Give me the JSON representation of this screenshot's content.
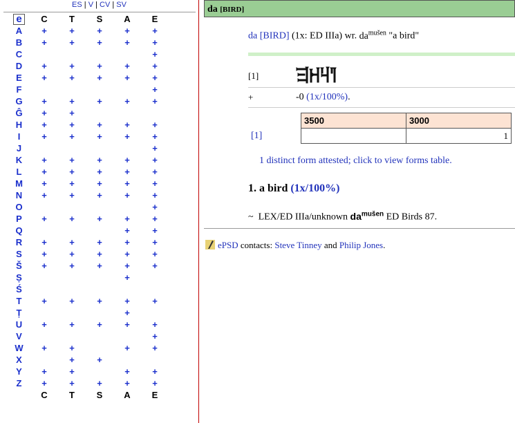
{
  "nav": {
    "links": [
      "ES",
      "V",
      "CV",
      "SV"
    ],
    "sep": "|"
  },
  "letter_grid": {
    "columns": [
      "C",
      "T",
      "S",
      "A",
      "E"
    ],
    "selected": "e",
    "rows": [
      {
        "letter": "A",
        "marks": [
          "+",
          "+",
          "+",
          "+",
          "+"
        ]
      },
      {
        "letter": "B",
        "marks": [
          "+",
          "+",
          "+",
          "+",
          "+"
        ]
      },
      {
        "letter": "C",
        "marks": [
          "",
          "",
          "",
          "",
          "+"
        ]
      },
      {
        "letter": "D",
        "marks": [
          "+",
          "+",
          "+",
          "+",
          "+"
        ]
      },
      {
        "letter": "E",
        "marks": [
          "+",
          "+",
          "+",
          "+",
          "+"
        ]
      },
      {
        "letter": "F",
        "marks": [
          "",
          "",
          "",
          "",
          "+"
        ]
      },
      {
        "letter": "G",
        "marks": [
          "+",
          "+",
          "+",
          "+",
          "+"
        ]
      },
      {
        "letter": "Ĝ",
        "marks": [
          "+",
          "+",
          "",
          "",
          ""
        ]
      },
      {
        "letter": "H",
        "marks": [
          "+",
          "+",
          "+",
          "+",
          "+"
        ]
      },
      {
        "letter": "I",
        "marks": [
          "+",
          "+",
          "+",
          "+",
          "+"
        ]
      },
      {
        "letter": "J",
        "marks": [
          "",
          "",
          "",
          "",
          "+"
        ]
      },
      {
        "letter": "K",
        "marks": [
          "+",
          "+",
          "+",
          "+",
          "+"
        ]
      },
      {
        "letter": "L",
        "marks": [
          "+",
          "+",
          "+",
          "+",
          "+"
        ]
      },
      {
        "letter": "M",
        "marks": [
          "+",
          "+",
          "+",
          "+",
          "+"
        ]
      },
      {
        "letter": "N",
        "marks": [
          "+",
          "+",
          "+",
          "+",
          "+"
        ]
      },
      {
        "letter": "O",
        "marks": [
          "",
          "",
          "",
          "",
          "+"
        ]
      },
      {
        "letter": "P",
        "marks": [
          "+",
          "+",
          "+",
          "+",
          "+"
        ]
      },
      {
        "letter": "Q",
        "marks": [
          "",
          "",
          "",
          "+",
          "+"
        ]
      },
      {
        "letter": "R",
        "marks": [
          "+",
          "+",
          "+",
          "+",
          "+"
        ]
      },
      {
        "letter": "S",
        "marks": [
          "+",
          "+",
          "+",
          "+",
          "+"
        ]
      },
      {
        "letter": "Š",
        "marks": [
          "+",
          "+",
          "+",
          "+",
          "+"
        ]
      },
      {
        "letter": "Ṣ",
        "marks": [
          "",
          "",
          "",
          "+",
          ""
        ]
      },
      {
        "letter": "Ś",
        "marks": [
          "",
          "",
          "",
          "",
          ""
        ]
      },
      {
        "letter": "T",
        "marks": [
          "+",
          "+",
          "+",
          "+",
          "+"
        ]
      },
      {
        "letter": "Ṭ",
        "marks": [
          "",
          "",
          "",
          "+",
          ""
        ]
      },
      {
        "letter": "U",
        "marks": [
          "+",
          "+",
          "+",
          "+",
          "+"
        ]
      },
      {
        "letter": "V",
        "marks": [
          "",
          "",
          "",
          "",
          "+"
        ]
      },
      {
        "letter": "W",
        "marks": [
          "+",
          "+",
          "",
          "+",
          "+"
        ]
      },
      {
        "letter": "X",
        "marks": [
          "",
          "+",
          "+",
          "",
          ""
        ]
      },
      {
        "letter": "Y",
        "marks": [
          "+",
          "+",
          "",
          "+",
          "+"
        ]
      },
      {
        "letter": "Z",
        "marks": [
          "+",
          "+",
          "+",
          "+",
          "+"
        ]
      }
    ]
  },
  "banner": {
    "word": "da",
    "gloss": "[BIRD]"
  },
  "entry": {
    "cf": "da",
    "gw": "[BIRD]",
    "count": "(1x: ED IIIa)",
    "wr": "wr.",
    "base": "da",
    "det": "mušen",
    "meaning": "\"a bird\""
  },
  "form": {
    "ref": "[1]"
  },
  "freq": {
    "plus": "+",
    "text": "-0",
    "pct": "(1x/100%)",
    "end": "."
  },
  "period_table": {
    "headers": [
      "3500",
      "3000"
    ],
    "row_ref": "[1]",
    "values": [
      "",
      "1"
    ]
  },
  "forms_note": "1 distinct form attested; click to view forms table.",
  "sense": {
    "num": "1.",
    "label": "a bird",
    "pct": "(1x/100%)"
  },
  "lex": {
    "tilde": "~",
    "src": "LEX/ED IIIa/unknown",
    "base": "da",
    "det": "mušen",
    "ref": "ED Birds 87."
  },
  "contacts": {
    "site": "ePSD",
    "label": "contacts:",
    "person1": "Steve Tinney",
    "and": "and",
    "person2": "Philip Jones",
    "end": "."
  },
  "colors": {
    "link": "#2233bb",
    "banner": "#9acd94",
    "table_head": "#fde3d3",
    "divider": "#c00000"
  }
}
